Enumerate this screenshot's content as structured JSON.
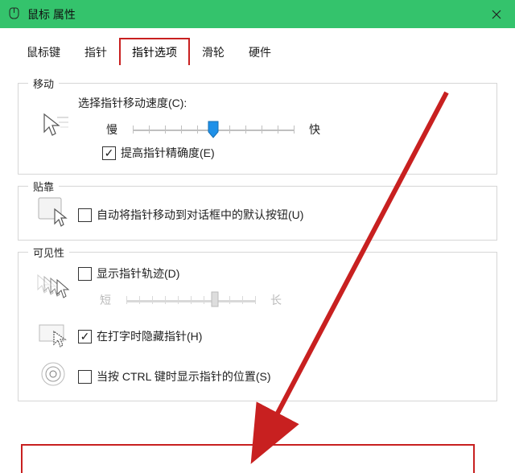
{
  "title": "鼠标 属性",
  "tabs": {
    "buttons": "鼠标键",
    "pointers": "指针",
    "pointer_options": "指针选项",
    "wheel": "滑轮",
    "hardware": "硬件"
  },
  "active_tab": "pointer_options",
  "groups": {
    "motion": {
      "legend": "移动",
      "speed_label": "选择指针移动速度(C):",
      "slow": "慢",
      "fast": "快",
      "speed_value": 5,
      "speed_max": 10,
      "enhance_precision_label": "提高指针精确度(E)",
      "enhance_precision_checked": true
    },
    "snap": {
      "legend": "贴靠",
      "snap_label": "自动将指针移动到对话框中的默认按钮(U)",
      "snap_checked": false
    },
    "visibility": {
      "legend": "可见性",
      "trails_label": "显示指针轨迹(D)",
      "trails_checked": false,
      "trails_short": "短",
      "trails_long": "长",
      "trails_value": 7,
      "trails_max": 10,
      "trails_enabled": false,
      "hide_typing_label": "在打字时隐藏指针(H)",
      "hide_typing_checked": true,
      "show_ctrl_label": "当按 CTRL 键时显示指针的位置(S)",
      "show_ctrl_checked": false
    }
  },
  "colors": {
    "titlebar": "#34c36c",
    "highlight": "#c82020"
  }
}
